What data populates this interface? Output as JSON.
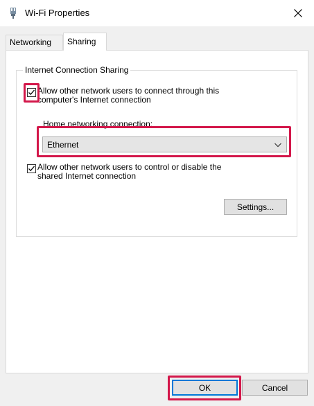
{
  "window": {
    "title": "Wi-Fi Properties"
  },
  "tabs": [
    {
      "label": "Networking",
      "selected": false
    },
    {
      "label": "Sharing",
      "selected": true
    }
  ],
  "sharing": {
    "group_title": "Internet Connection Sharing",
    "allow_connect": {
      "checked": true,
      "label_line1": "Allow other network users to connect through this",
      "label_line2": "computer's Internet connection"
    },
    "home_networking_label": "Home networking connection:",
    "home_networking_value": "Ethernet",
    "allow_control": {
      "checked": true,
      "label_line1": "Allow other network users to control or disable the",
      "label_line2": "shared Internet connection"
    },
    "settings_button": "Settings..."
  },
  "footer": {
    "ok_label": "OK",
    "cancel_label": "Cancel"
  },
  "colors": {
    "highlight": "#d3174a",
    "accent": "#0078d7"
  },
  "icons": {
    "title": "wifi-adapter-icon",
    "close": "close-icon",
    "check": "checkmark-icon",
    "dropdown": "chevron-down-icon"
  }
}
